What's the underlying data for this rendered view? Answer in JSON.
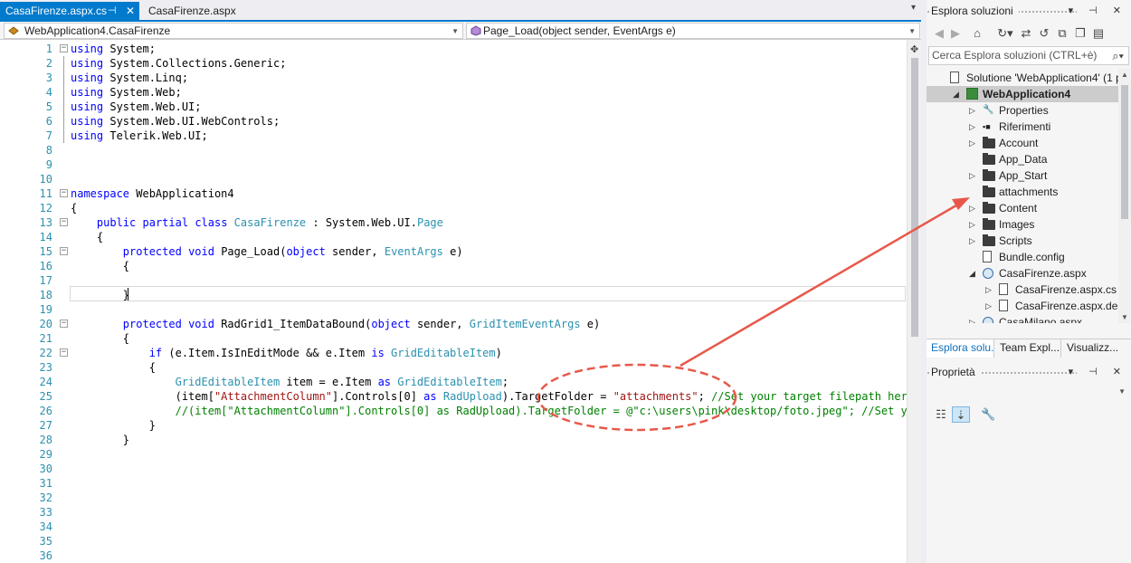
{
  "editor": {
    "tabs": [
      {
        "label": "CasaFirenze.aspx.cs",
        "active": true,
        "pin": "⊣",
        "close": "✕"
      },
      {
        "label": "CasaFirenze.aspx",
        "active": false
      }
    ],
    "nav_class": "WebApplication4.CasaFirenze",
    "nav_member": "Page_Load(object sender, EventArgs e)",
    "lines": [
      {
        "n": "1"
      },
      {
        "n": "2"
      },
      {
        "n": "3"
      },
      {
        "n": "4"
      },
      {
        "n": "5"
      },
      {
        "n": "6"
      },
      {
        "n": "7"
      },
      {
        "n": "8"
      },
      {
        "n": "9"
      },
      {
        "n": "10"
      },
      {
        "n": "11"
      },
      {
        "n": "12"
      },
      {
        "n": "13"
      },
      {
        "n": "14"
      },
      {
        "n": "15"
      },
      {
        "n": "16"
      },
      {
        "n": "17"
      },
      {
        "n": "18"
      },
      {
        "n": "19"
      },
      {
        "n": "20"
      },
      {
        "n": "21"
      },
      {
        "n": "22"
      },
      {
        "n": "23"
      },
      {
        "n": "24"
      },
      {
        "n": "25"
      },
      {
        "n": "26"
      },
      {
        "n": "27"
      },
      {
        "n": "28"
      },
      {
        "n": "29"
      },
      {
        "n": "30"
      },
      {
        "n": "31"
      },
      {
        "n": "32"
      },
      {
        "n": "33"
      },
      {
        "n": "34"
      },
      {
        "n": "35"
      },
      {
        "n": "36"
      }
    ],
    "code": {
      "l1": [
        "using",
        " System;"
      ],
      "l2": [
        "using",
        " System.Collections.Generic;"
      ],
      "l3": [
        "using",
        " System.Linq;"
      ],
      "l4": [
        "using",
        " System.Web;"
      ],
      "l5": [
        "using",
        " System.Web.UI;"
      ],
      "l6": [
        "using",
        " System.Web.UI.WebControls;"
      ],
      "l7": [
        "using",
        " Telerik.Web.UI;"
      ],
      "l11": [
        "namespace",
        " WebApplication4"
      ],
      "l12": "{",
      "l13": [
        "    ",
        "public",
        " ",
        "partial",
        " ",
        "class",
        " ",
        "CasaFirenze",
        " : System.Web.UI.",
        "Page"
      ],
      "l14": "    {",
      "l15": [
        "        ",
        "protected",
        " ",
        "void",
        " Page_Load(",
        "object",
        " sender, ",
        "EventArgs",
        " e)"
      ],
      "l16": "        {",
      "l18": "        }",
      "l20": [
        "        ",
        "protected",
        " ",
        "void",
        " RadGrid1_ItemDataBound(",
        "object",
        " sender, ",
        "GridItemEventArgs",
        " e)"
      ],
      "l21": "        {",
      "l22": [
        "            ",
        "if",
        " (e.Item.IsInEditMode && e.Item ",
        "is",
        " ",
        "GridEditableItem",
        ")"
      ],
      "l23": "            {",
      "l24": [
        "                ",
        "GridEditableItem",
        " item = e.Item ",
        "as",
        " ",
        "GridEditableItem",
        ";"
      ],
      "l25": [
        "                (item[",
        "\"AttachmentColumn\"",
        "].Controls[0] ",
        "as",
        " ",
        "RadUpload",
        ").TargetFolder = ",
        "\"attachments\"",
        "; ",
        "//Set your target filepath here"
      ],
      "l26": [
        "                ",
        "//(item[\"AttachmentColumn\"].Controls[0] as RadUpload).TargetFolder = @\"c:\\users\\pink\\desktop/foto.jpeg\"; //Set your"
      ],
      "l27": "            }",
      "l28": "        }"
    }
  },
  "solution_explorer": {
    "title": "Esplora soluzioni",
    "controls": "▾ ⊣ ✕",
    "search_placeholder": "Cerca Esplora soluzioni (CTRL+è)",
    "tree": [
      {
        "label": "Solutione 'WebApplication4' (1 p",
        "icon": "solution-icon"
      },
      {
        "label": "WebApplication4",
        "icon": "project-icon"
      },
      {
        "label": "Properties",
        "icon": "wrench-icon"
      },
      {
        "label": "Riferimenti",
        "icon": "references-icon"
      },
      {
        "label": "Account",
        "icon": "folder-icon"
      },
      {
        "label": "App_Data",
        "icon": "folder-icon"
      },
      {
        "label": "App_Start",
        "icon": "folder-icon"
      },
      {
        "label": "attachments",
        "icon": "folder-icon"
      },
      {
        "label": "Content",
        "icon": "folder-icon"
      },
      {
        "label": "Images",
        "icon": "folder-icon"
      },
      {
        "label": "Scripts",
        "icon": "folder-icon"
      },
      {
        "label": "Bundle.config",
        "icon": "file-icon"
      },
      {
        "label": "CasaFirenze.aspx",
        "icon": "web-form-icon"
      },
      {
        "label": "CasaFirenze.aspx.cs",
        "icon": "cs-file-icon"
      },
      {
        "label": "CasaFirenze.aspx.desig",
        "icon": "cs-file-icon"
      },
      {
        "label": "CasaMilano.aspx",
        "icon": "web-form-icon"
      }
    ],
    "tabs": [
      "Esplora solu...",
      "Team Expl...",
      "Visualizz..."
    ]
  },
  "properties": {
    "title": "Proprietà",
    "controls": "▾ ⊣ ✕"
  },
  "colors": {
    "accent": "#007acc",
    "annotation": "#e8584a"
  }
}
